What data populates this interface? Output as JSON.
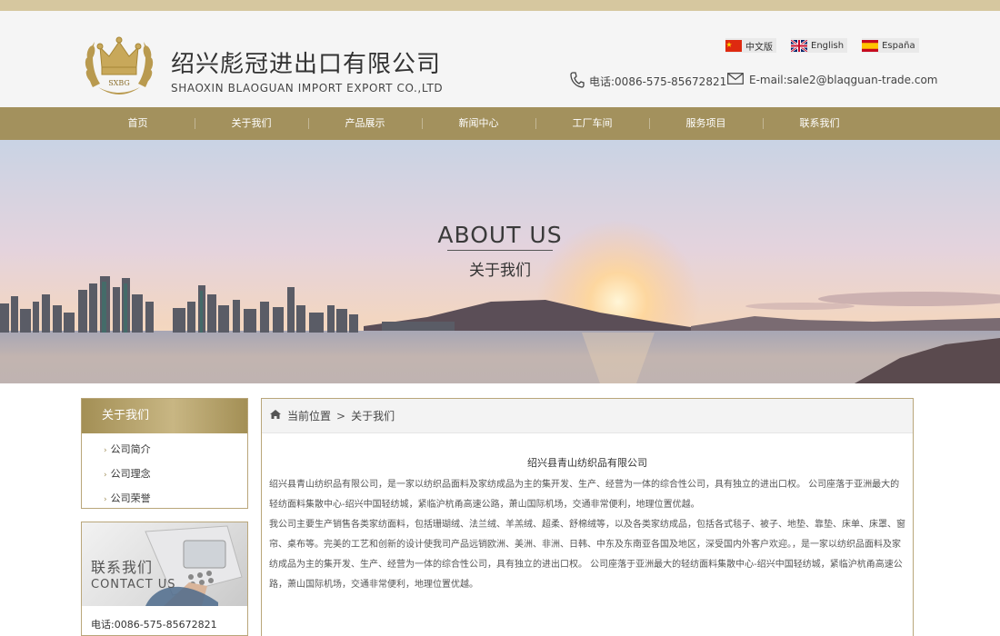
{
  "header": {
    "company_cn": "绍兴彪冠进出口有限公司",
    "company_en": "SHAOXIN BLAOGUAN IMPORT EXPORT CO.,LTD",
    "logo_text": "SXBG",
    "languages": [
      {
        "label": "中文版",
        "flag": "cn-flag"
      },
      {
        "label": "English",
        "flag": "uk-flag"
      },
      {
        "label": "España",
        "flag": "es-flag"
      }
    ],
    "phone": "电话:0086-575-85672821",
    "email": "E-mail:sale2@blaqguan-trade.com"
  },
  "nav": {
    "items": [
      "首页",
      "关于我们",
      "产品展示",
      "新闻中心",
      "工厂车间",
      "服务项目",
      "联系我们"
    ]
  },
  "banner": {
    "title": "ABOUT US",
    "subtitle": "关于我们"
  },
  "sidebar": {
    "heading": "关于我们",
    "items": [
      "公司简介",
      "公司理念",
      "公司荣誉"
    ],
    "contact_cn": "联系我们",
    "contact_en": "CONTACT US",
    "contact_phone": "电话:0086-575-85672821"
  },
  "main": {
    "breadcrumb_current_label": "当前位置",
    "breadcrumb_sep": ">",
    "breadcrumb_page": "关于我们",
    "article_title": "绍兴县青山纺织品有限公司",
    "paragraphs": [
      "绍兴县青山纺织品有限公司，是一家以纺织品面料及家纺成品为主的集开发、生产、经营为一体的综合性公司，具有独立的进出口权。 公司座落于亚洲最大的轻纺面料集散中心-绍兴中国轻纺城，紧临沪杭甬高速公路，萧山国际机场，交通非常便利，地理位置优越。",
      "我公司主要生产销售各类家纺面料，包括珊瑚绒、法兰绒、羊羔绒、超柔、舒棉绒等，以及各类家纺成品，包括各式毯子、被子、地垫、靠垫、床单、床罩、窗帘、桌布等。完美的工艺和创新的设计使我司产品远销欧洲、美洲、非洲、日韩、中东及东南亚各国及地区，深受国内外客户欢迎。，是一家以纺织品面料及家纺成品为主的集开发、生产、经营为一体的综合性公司，具有独立的进出口权。 公司座落于亚洲最大的轻纺面料集散中心-绍兴中国轻纺城，紧临沪杭甬高速公路，萧山国际机场，交通非常便利，地理位置优越。"
    ]
  },
  "colors": {
    "gold": "#a3915d",
    "top_strip": "#d6c79f",
    "header_bg": "#f5f5f5"
  }
}
